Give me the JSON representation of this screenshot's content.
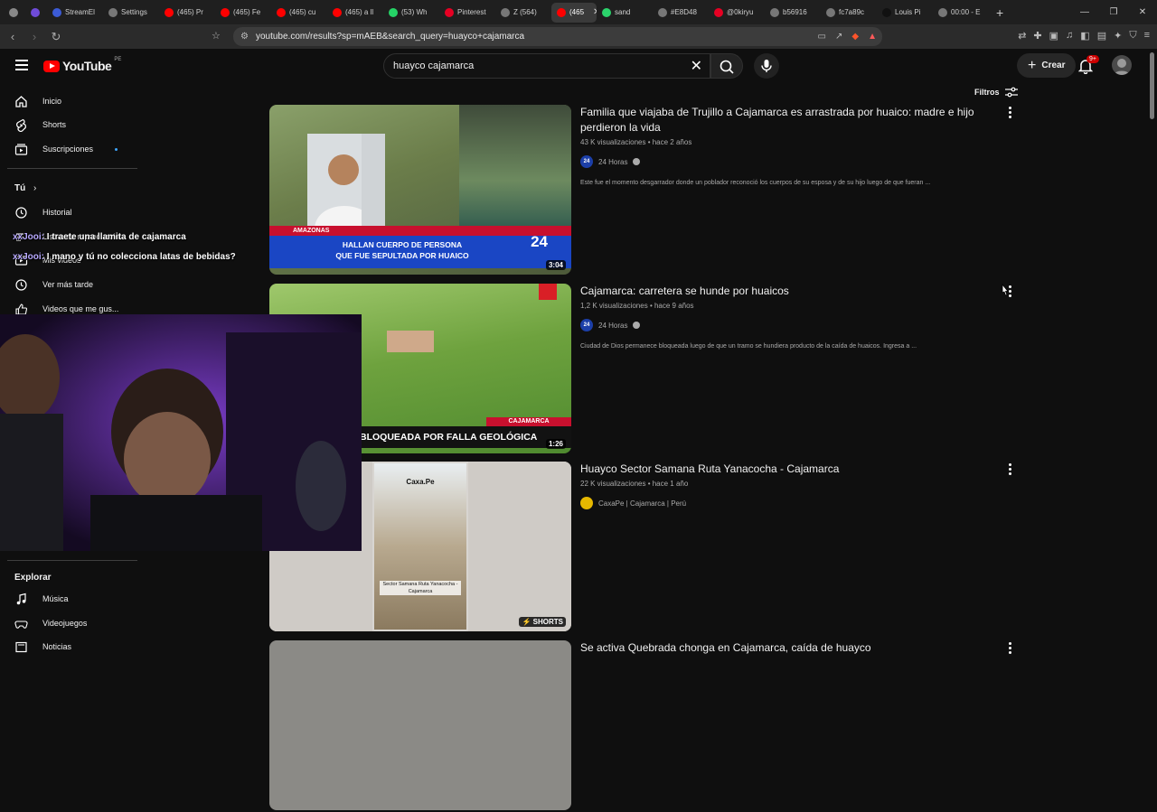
{
  "browser": {
    "tabs": [
      {
        "label": "",
        "color": "#888888"
      },
      {
        "label": "",
        "color": "#6f4bd8"
      },
      {
        "label": "StreamEl",
        "color": "#3c5bd6"
      },
      {
        "label": "Settings",
        "color": "#777777"
      },
      {
        "label": "(465) Pr",
        "color": "#ff0000"
      },
      {
        "label": "(465) Fe",
        "color": "#ff0000"
      },
      {
        "label": "(465) cu",
        "color": "#ff0000"
      },
      {
        "label": "(465) a ll",
        "color": "#ff0000"
      },
      {
        "label": "(53) Wh",
        "color": "#25d366"
      },
      {
        "label": "Pinterest",
        "color": "#e60023"
      },
      {
        "label": "Z (564)",
        "color": "#777777"
      },
      {
        "label": "(465",
        "color": "#ff0000",
        "active": true
      },
      {
        "label": "sand",
        "color": "#2bd36b"
      },
      {
        "label": "#E8D48",
        "color": "#777777"
      },
      {
        "label": "@0kiryu",
        "color": "#e60023"
      },
      {
        "label": "b56916",
        "color": "#777777"
      },
      {
        "label": "fc7a89c",
        "color": "#777777"
      },
      {
        "label": "Louis Pi",
        "color": "#111111"
      },
      {
        "label": "00:00 - E",
        "color": "#777777"
      }
    ],
    "new_tab": "+",
    "url": "youtube.com/results?sp=mAEB&search_query=huayco+cajamarca"
  },
  "youtube": {
    "logo": "YouTube",
    "country": "PE",
    "search_value": "huayco cajamarca",
    "create_label": "Crear",
    "notif_badge": "9+",
    "filters_label": "Filtros"
  },
  "sidebar": {
    "items": [
      {
        "label": "Inicio",
        "icon": "home-icon"
      },
      {
        "label": "Shorts",
        "icon": "shorts-icon"
      },
      {
        "label": "Suscripciones",
        "icon": "subscriptions-icon"
      }
    ],
    "you_title": "Tú",
    "you_items": [
      {
        "label": "Historial",
        "icon": "history-icon"
      },
      {
        "label": "Listas de reproducción",
        "icon": "playlist-icon"
      },
      {
        "label": "Mis videos",
        "icon": "my-videos-icon"
      },
      {
        "label": "Ver más tarde",
        "icon": "watch-later-icon"
      },
      {
        "label": "Videos que me gus...",
        "icon": "liked-icon"
      }
    ],
    "explore_title": "Explorar",
    "explore_items": [
      {
        "label": "Música",
        "icon": "music-icon"
      },
      {
        "label": "Videojuegos",
        "icon": "gaming-icon"
      },
      {
        "label": "Noticias",
        "icon": "news-icon"
      }
    ]
  },
  "chat": [
    {
      "user": "xxJooi:",
      "text": "I traete una llamita de cajamarca"
    },
    {
      "user": "xxJooi:",
      "text": "I mano y tú no colecciona latas de bebidas?"
    }
  ],
  "results": [
    {
      "title": "Familia que viajaba de Trujillo a Cajamarca es arrastrada por huaico: madre e hijo perdieron la vida",
      "views": "43 K visualizaciones",
      "age": "hace 2 años",
      "channel": "24 Horas",
      "channel_avatar": "24",
      "desc": "Este fue el momento desgarrador donde un poblador reconoció los cuerpos de su esposa y de su hijo luego de que fueran ...",
      "duration": "3:04",
      "banner_tag": "AMAZONAS",
      "banner_line1": "HALLAN CUERPO DE PERSONA",
      "banner_line2": "QUE FUE SEPULTADA POR HUAICO",
      "banner_logo": "24"
    },
    {
      "title": "Cajamarca: carretera se hunde por huaicos",
      "views": "1,2 K visualizaciones",
      "age": "hace 9 años",
      "channel": "24 Horas",
      "channel_avatar": "24",
      "desc": "Ciudad de Dios permanece bloqueada luego de que un tramo se hundiera producto de la caída de huaicos. Ingresa a ...",
      "duration": "1:26",
      "banner_tag": "CAJAMARCA",
      "banner_line1": "BLOQUEADA POR FALLA GEOLÓGICA"
    },
    {
      "title": "Huayco Sector Samana Ruta Yanacocha - Cajamarca",
      "views": "22 K visualizaciones",
      "age": "hace 1 año",
      "channel": "CaxaPe | Cajamarca | Perú",
      "duration": "SHORTS",
      "overlay_top": "Caxa.Pe",
      "overlay_bottom": "Sector Samana Ruta Yanacocha - Cajamarca"
    },
    {
      "title": "Se activa Quebrada chonga en Cajamarca, caída de huayco"
    }
  ]
}
